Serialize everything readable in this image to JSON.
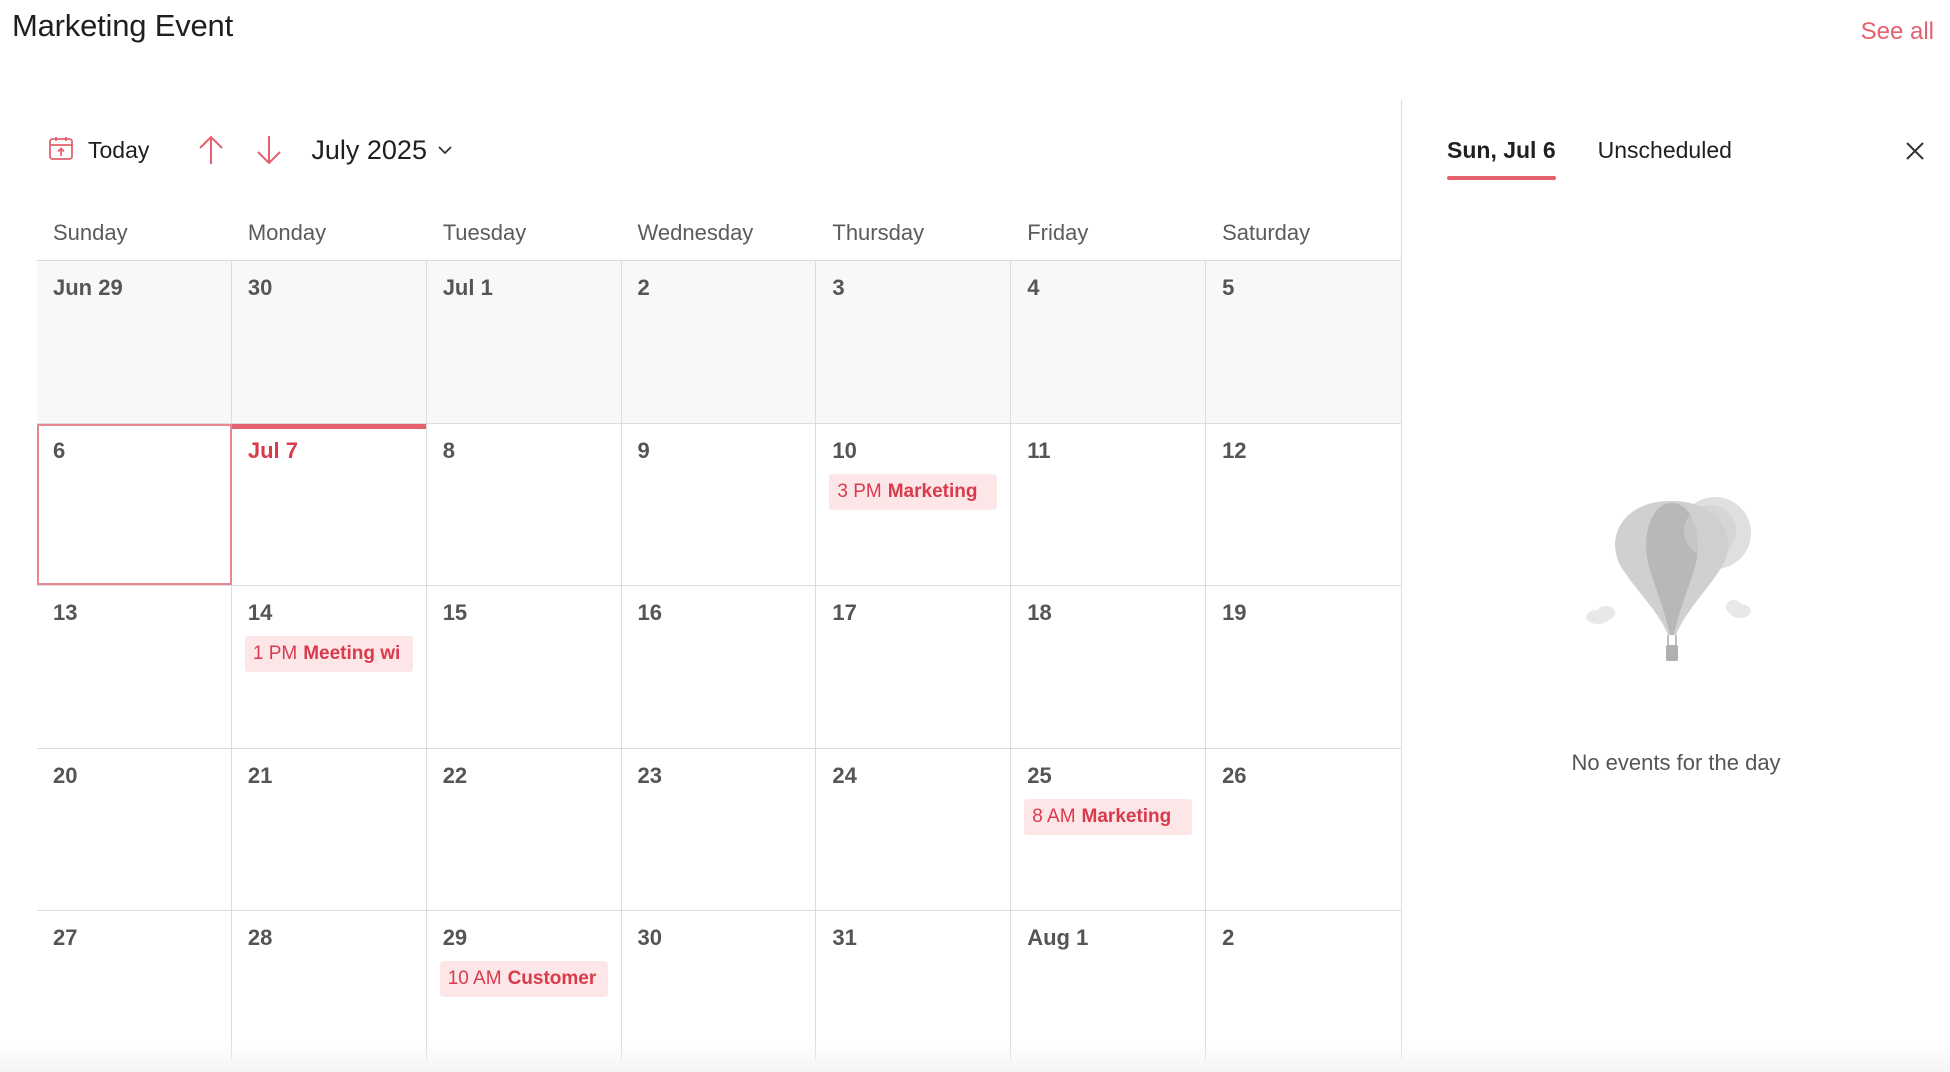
{
  "header": {
    "title": "Marketing Event",
    "see_all": "See all"
  },
  "toolbar": {
    "today_label": "Today",
    "today_icon": "calendar-today-icon",
    "prev_icon": "arrow-up-icon",
    "next_icon": "arrow-down-icon",
    "month_label": "July 2025",
    "month_dropdown_icon": "chevron-down-icon"
  },
  "colors": {
    "accent": "#e5616f",
    "event_bg": "#fde6e8",
    "event_text": "#d93a4c",
    "muted_bg": "#f8f8f8",
    "grid_line": "#dcdcdc"
  },
  "calendar": {
    "weekdays": [
      "Sunday",
      "Monday",
      "Tuesday",
      "Wednesday",
      "Thursday",
      "Friday",
      "Saturday"
    ],
    "weeks": [
      {
        "days": [
          {
            "label": "Jun 29",
            "muted": true
          },
          {
            "label": "30",
            "muted": true
          },
          {
            "label": "Jul 1",
            "muted": true
          },
          {
            "label": "2",
            "muted": true
          },
          {
            "label": "3",
            "muted": true
          },
          {
            "label": "4",
            "muted": true
          },
          {
            "label": "5",
            "muted": true
          }
        ]
      },
      {
        "days": [
          {
            "label": "6",
            "selected": true
          },
          {
            "label": "Jul 7",
            "today": true
          },
          {
            "label": "8"
          },
          {
            "label": "9"
          },
          {
            "label": "10",
            "event": {
              "time": "3 PM",
              "title": "Marketing"
            }
          },
          {
            "label": "11"
          },
          {
            "label": "12"
          }
        ]
      },
      {
        "days": [
          {
            "label": "13"
          },
          {
            "label": "14",
            "event": {
              "time": "1 PM",
              "title": "Meeting wi"
            }
          },
          {
            "label": "15"
          },
          {
            "label": "16"
          },
          {
            "label": "17"
          },
          {
            "label": "18"
          },
          {
            "label": "19"
          }
        ]
      },
      {
        "days": [
          {
            "label": "20"
          },
          {
            "label": "21"
          },
          {
            "label": "22"
          },
          {
            "label": "23"
          },
          {
            "label": "24"
          },
          {
            "label": "25",
            "event": {
              "time": "8 AM",
              "title": "Marketing"
            }
          },
          {
            "label": "26"
          }
        ]
      },
      {
        "days": [
          {
            "label": "27"
          },
          {
            "label": "28"
          },
          {
            "label": "29",
            "event": {
              "time": "10 AM",
              "title": "Customer"
            }
          },
          {
            "label": "30"
          },
          {
            "label": "31"
          },
          {
            "label": "Aug 1"
          },
          {
            "label": "2"
          }
        ]
      }
    ]
  },
  "panel": {
    "tabs": [
      {
        "label": "Sun, Jul 6",
        "active": true
      },
      {
        "label": "Unscheduled",
        "active": false
      }
    ],
    "close_icon": "close-icon",
    "empty_illustration": "hot-air-balloon-icon",
    "empty_text": "No events for the day"
  }
}
